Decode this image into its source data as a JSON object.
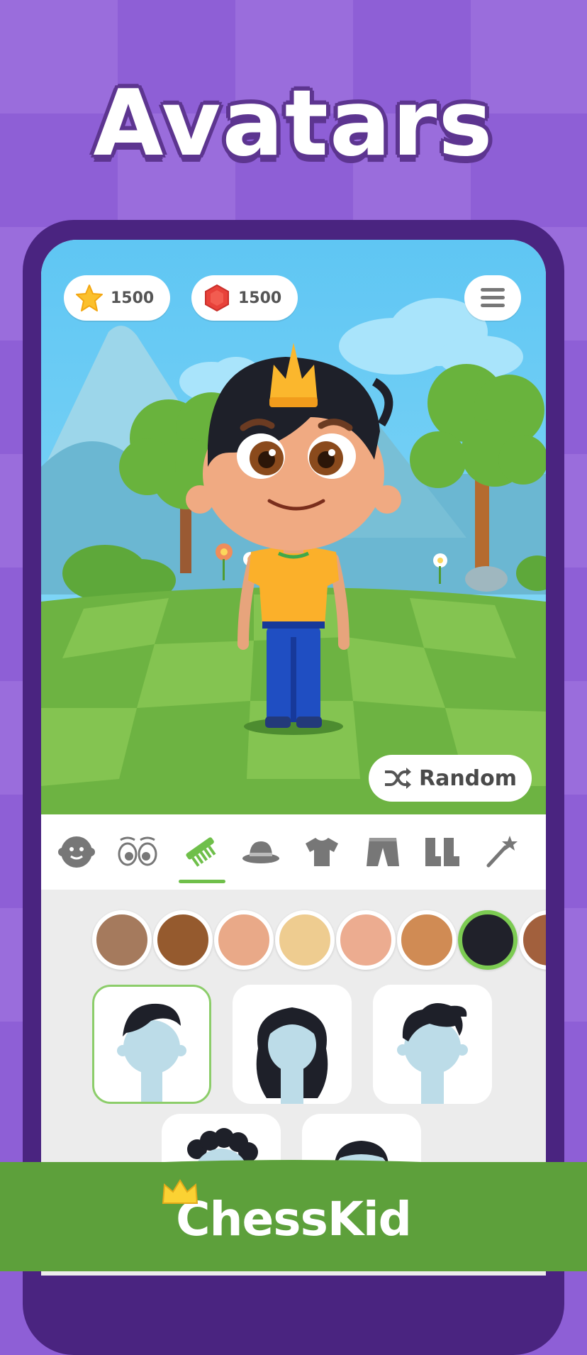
{
  "page": {
    "title": "Avatars"
  },
  "header": {
    "coins": {
      "icon": "star-coin-icon",
      "value": "1500"
    },
    "gems": {
      "icon": "red-gem-icon",
      "value": "1500"
    },
    "menu_icon": "hamburger-menu-icon"
  },
  "random_button": {
    "label": "Random",
    "icon": "shuffle-icon"
  },
  "category_tabs": [
    {
      "icon": "face-icon",
      "selected": false
    },
    {
      "icon": "eyes-icon",
      "selected": false
    },
    {
      "icon": "comb-hair-icon",
      "selected": true
    },
    {
      "icon": "hat-icon",
      "selected": false
    },
    {
      "icon": "shirt-icon",
      "selected": false
    },
    {
      "icon": "pants-icon",
      "selected": false
    },
    {
      "icon": "boots-icon",
      "selected": false
    },
    {
      "icon": "magic-wand-icon",
      "selected": false
    }
  ],
  "hair_colors": [
    {
      "color": "#a57a5d",
      "selected": false
    },
    {
      "color": "#955a2e",
      "selected": false
    },
    {
      "color": "#e9a988",
      "selected": false
    },
    {
      "color": "#eecc90",
      "selected": false
    },
    {
      "color": "#ecac90",
      "selected": false
    },
    {
      "color": "#d08b54",
      "selected": false
    },
    {
      "color": "#20212a",
      "selected": true
    },
    {
      "color": "#a2603d",
      "selected": false
    }
  ],
  "hair_styles": [
    {
      "icon": "side-swept-hair-icon",
      "selected": true
    },
    {
      "icon": "long-wavy-hair-icon",
      "selected": false
    },
    {
      "icon": "spiky-hair-icon",
      "selected": false
    },
    {
      "icon": "curly-hair-icon",
      "selected": false
    },
    {
      "icon": "short-hair-icon",
      "selected": false
    }
  ],
  "brand": {
    "logo_text": "ChessKid",
    "icon": "crown-icon"
  },
  "colors": {
    "background_purple": "#8e5fd6",
    "phone_frame": "#4a2480",
    "sky": "#66ccf5",
    "grass_light": "#7cbf49",
    "grass_dark": "#5ea83a",
    "accent_green": "#7ccb52"
  }
}
